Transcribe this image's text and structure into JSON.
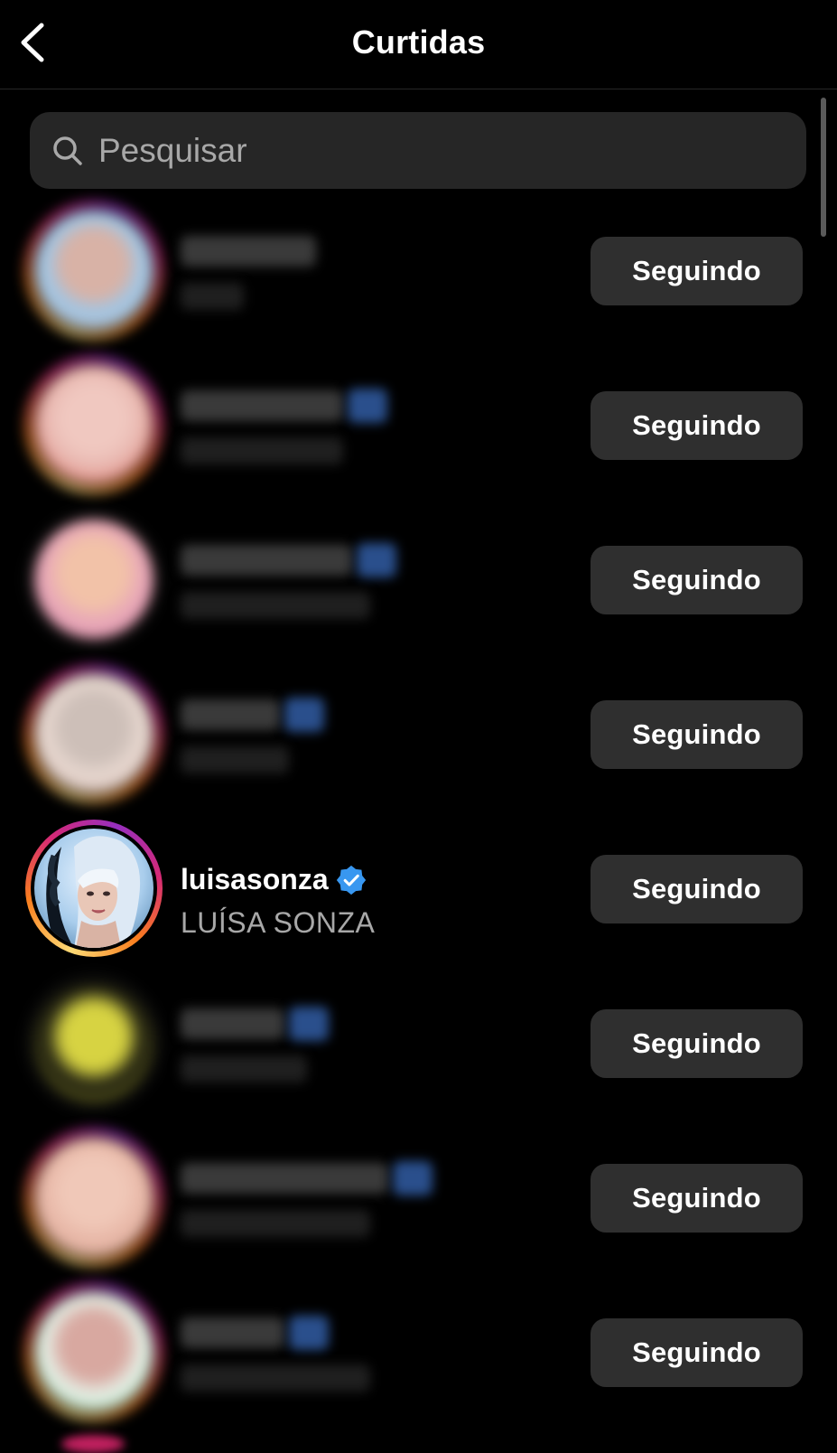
{
  "header": {
    "title": "Curtidas",
    "back_icon": "chevron-left-icon"
  },
  "search": {
    "placeholder": "Pesquisar",
    "value": "",
    "icon": "search-icon"
  },
  "colors": {
    "background": "#000000",
    "button_bg": "#2f2f2f",
    "verified_blue": "#3897f0",
    "secondary_text": "#a8a8a8"
  },
  "users": [
    {
      "username": "",
      "fullname": "",
      "blurred": true,
      "verified": false,
      "story_ring": true,
      "button_label": "Seguindo"
    },
    {
      "username": "",
      "fullname": "",
      "blurred": true,
      "verified": true,
      "story_ring": true,
      "button_label": "Seguindo"
    },
    {
      "username": "",
      "fullname": "",
      "blurred": true,
      "verified": true,
      "story_ring": false,
      "button_label": "Seguindo"
    },
    {
      "username": "",
      "fullname": "",
      "blurred": true,
      "verified": true,
      "story_ring": true,
      "button_label": "Seguindo"
    },
    {
      "username": "luisasonza",
      "fullname": "LUÍSA SONZA",
      "blurred": false,
      "verified": true,
      "story_ring": true,
      "button_label": "Seguindo"
    },
    {
      "username": "",
      "fullname": "",
      "blurred": true,
      "verified": true,
      "story_ring": false,
      "button_label": "Seguindo"
    },
    {
      "username": "",
      "fullname": "",
      "blurred": true,
      "verified": true,
      "story_ring": true,
      "button_label": "Seguindo"
    },
    {
      "username": "",
      "fullname": "",
      "blurred": true,
      "verified": true,
      "story_ring": true,
      "button_label": "Seguindo"
    }
  ]
}
